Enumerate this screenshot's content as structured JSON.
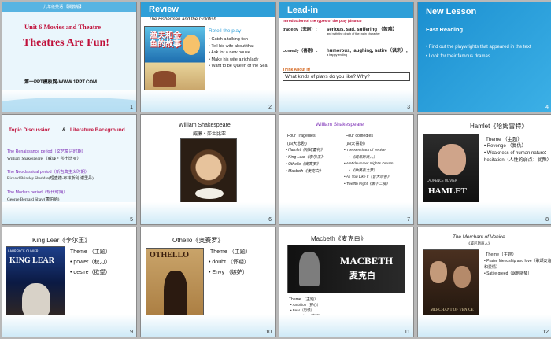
{
  "slides": {
    "s1": {
      "num": "1",
      "top_tag": "九年级英语 【冀教版】",
      "unit": "Unit 6 Movies and Theatre",
      "title": "Theatres Are Fun!",
      "footer": "第一PPT模板网-WWW.1PPT.COM"
    },
    "s2": {
      "num": "2",
      "title": "Review",
      "subtitle": "The Fisherman and the Goldfish",
      "book_text": "渔夫和金鱼的故事",
      "retell": "Retell the play",
      "items": [
        "Catch a talking fish",
        "Tell his wife about that",
        "Ask for a new house",
        "Make his wife a rich lady",
        "Want to be Queen of the Sea"
      ]
    },
    "s3": {
      "num": "3",
      "title": "Lead-in",
      "intro": "Introduction of the types of the play (drama)",
      "tragedy_label": "tragedy（悲剧）:",
      "tragedy_def": "serious, sad, suffering （苦难）,",
      "tragedy_def2": "and with the death of the main character",
      "comedy_label": "comedy（喜剧）:",
      "comedy_def": "humorous, laughing, satire（讽刺）,",
      "comedy_def2": "a happy ending",
      "think": "Think About It！",
      "question": "What kinds of plays do you like? Why?"
    },
    "s4": {
      "num": "4",
      "title": "New Lesson",
      "sub": "Fast Reading",
      "items": [
        "Find out the playwrights that appeared in the text",
        "Look for their famous dramas."
      ]
    },
    "s5": {
      "num": "5",
      "h1": "Topic Discussion",
      "amp": "&",
      "h2": "Literature Background",
      "p1": "The Renaissance period（文艺复兴时期）",
      "p1b": "William  Shakespeare （威廉・莎士比亚）",
      "p2": "The Neoclassical period（新古典主义时期）",
      "p2b": "Richard Brinsley Sheridan(理查德·布林斯利·谢里丹)",
      "p3": "The Modern period（现代时期）",
      "p3b": "George Bernard Shaw(萧伯纳)"
    },
    "s6": {
      "num": "6",
      "title": "William Shakespeare",
      "cn": "威廉・莎士比亚"
    },
    "s7": {
      "num": "7",
      "title": "William Shakespeare",
      "col1_head": "Four Tragedies",
      "col1_cn": "(四大悲剧)",
      "col1": [
        "Hamlet《哈姆雷特》",
        "King Lear《李尔王》",
        "Othello《奥赛罗》",
        "Macbeth《麦克白》"
      ],
      "col2_head": "Four comedies",
      "col2_cn": "(四大喜剧)",
      "col2": [
        "The Merchant of Venice",
        "《威尼斯商人》",
        "A Midsummer Night's Dream",
        "《仲夏夜之梦》",
        "As You Like It《皆大欢喜》",
        "Twelfth Night《第十二夜》"
      ]
    },
    "s8": {
      "num": "8",
      "title": "Hamlet《哈姆雷特》",
      "theme": "Theme （主题）",
      "items": [
        "Revenge （复仇）",
        "Weakness of human nature：hesitation（人性的弱点：犹豫）"
      ],
      "poster_top": "LAURENCE OLIVIER",
      "poster_title": "HAMLET"
    },
    "s9": {
      "num": "9",
      "title": "King Lear《李尔王》",
      "theme": "Theme （主题）",
      "items": [
        "power（权力）",
        "desire（欲望）"
      ],
      "poster_top": "LAURENCE OLIVIER",
      "poster_title": "KING LEAR"
    },
    "s10": {
      "num": "10",
      "title": "Othello《奥赛罗》",
      "theme": "Theme （主题）",
      "items": [
        "doubt （怀疑）",
        "Envy （嫉妒）"
      ],
      "poster_title": "OTHELLO"
    },
    "s11": {
      "num": "11",
      "title": "Macbeth《麦克白》",
      "theme": "Theme （主题）",
      "items": [
        "Ambition（野心）",
        "Fear（恐惧）",
        "Suspicion（猜疑）"
      ],
      "poster_title": "MACBETH",
      "poster_cn": "麦克白"
    },
    "s12": {
      "num": "12",
      "title": "The Merchant of Venice",
      "cn": "《威尼斯商人》",
      "theme": "Theme（主题）",
      "items": [
        "Praise friendship and love（歌颂友谊和爱情）",
        "Satire greed（讽刺贪婪）"
      ],
      "poster_title": "MERCHANT OF VENICE"
    }
  },
  "colors": {
    "accent_blue": "#2f9fd8",
    "red_title": "#c0103a",
    "purple": "#7a2bb5",
    "orange": "#d4641b"
  }
}
